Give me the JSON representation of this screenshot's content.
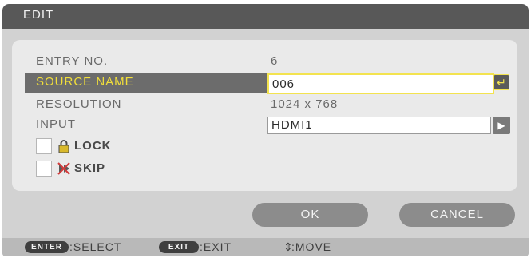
{
  "dialog": {
    "title": "EDIT",
    "fields": {
      "entry_no": {
        "label": "ENTRY NO.",
        "value": "6"
      },
      "source_name": {
        "label": "SOURCE NAME",
        "value": "006"
      },
      "resolution": {
        "label": "RESOLUTION",
        "value": "1024 x 768"
      },
      "input": {
        "label": "INPUT",
        "value": "HDMI1"
      }
    },
    "lock": {
      "label": "LOCK",
      "checked": false
    },
    "skip": {
      "label": "SKIP",
      "checked": false
    },
    "buttons": {
      "ok": "OK",
      "cancel": "CANCEL"
    }
  },
  "footer": {
    "enter_key": "ENTER",
    "select": ":SELECT",
    "exit_key": "EXIT",
    "exit": ":EXIT",
    "move": ":MOVE",
    "move_icon": "up-down-arrow-icon"
  },
  "colors": {
    "highlight_text": "#f2df3a",
    "selected_row": "#6c6c6c",
    "title_bar": "#585858"
  }
}
